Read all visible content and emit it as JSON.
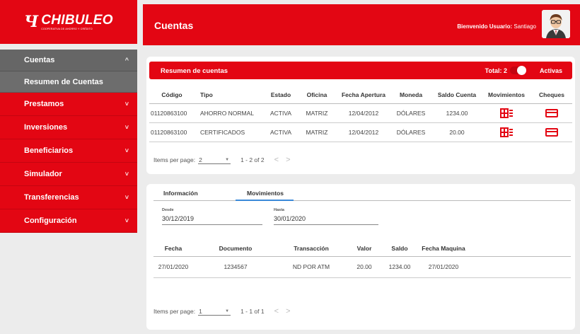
{
  "brand": {
    "logo_mark": "Ч",
    "name": "CHIBULEO",
    "tagline": "COOPERATIVA DE AHORRO Y CRÉDITO"
  },
  "sidebar": {
    "items": [
      {
        "label": "Cuentas",
        "chevron": "^"
      },
      {
        "label": "Resumen de Cuentas"
      },
      {
        "label": "Prestamos",
        "chevron": "˅"
      },
      {
        "label": "Inversiones",
        "chevron": "˅"
      },
      {
        "label": "Beneficiarios",
        "chevron": "˅"
      },
      {
        "label": "Simulador",
        "chevron": "˅"
      },
      {
        "label": "Transferencias",
        "chevron": "˅"
      },
      {
        "label": "Configuración",
        "chevron": "˅"
      }
    ]
  },
  "header": {
    "title": "Cuentas",
    "welcome_prefix": "Bienvenido Usuario:",
    "user_name": " Santiago"
  },
  "summary": {
    "title": "Resumen de cuentas",
    "total": "Total: 2",
    "toggle_label": "Activas",
    "columns": [
      "Código",
      "Tipo",
      "Estado",
      "Oficina",
      "Fecha Apertura",
      "Moneda",
      "Saldo Cuenta",
      "Movimientos",
      "Cheques"
    ],
    "rows": [
      [
        "01120863100",
        "AHORRO NORMAL",
        "ACTIVA",
        "MATRIZ",
        "12/04/2012",
        "DÓLARES",
        "1234.00"
      ],
      [
        "01120863100",
        "CERTIFICADOS",
        "ACTIVA",
        "MATRIZ",
        "12/04/2012",
        "DÓLARES",
        "20.00"
      ]
    ],
    "pager": {
      "label": "Items per page:",
      "size": "2",
      "range": "1 - 2 of 2",
      "prev": "<",
      "next": ">"
    }
  },
  "detail": {
    "tabs": [
      "Información",
      "Movimientos"
    ],
    "desde_label": "Desde",
    "desde_value": "30/12/2019",
    "hasta_label": "Hasta",
    "hasta_value": "30/01/2020",
    "columns": [
      "Fecha",
      "Documento",
      "Transacción",
      "Valor",
      "Saldo",
      "Fecha Maquina"
    ],
    "rows": [
      [
        "27/01/2020",
        "1234567",
        "ND POR ATM",
        "20.00",
        "1234.00",
        "27/01/2020"
      ]
    ],
    "pager": {
      "label": "Items per page:",
      "size": "1",
      "range": "1 - 1 of 1",
      "prev": "<",
      "next": ">"
    }
  },
  "colors": {
    "brand_red": "#e30613",
    "sidebar_active": "#666666",
    "tab_accent": "#3b8ad9"
  },
  "icons": {
    "movimientos": "ledger-icon",
    "cheques": "card-icon",
    "toggle": "toggle-switch"
  }
}
